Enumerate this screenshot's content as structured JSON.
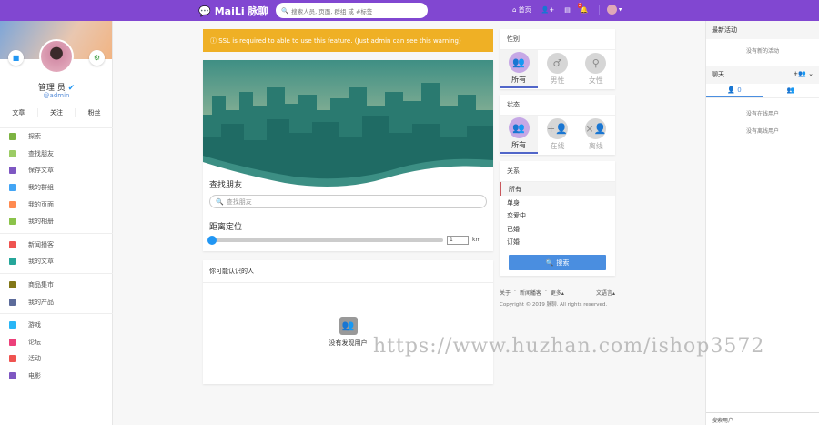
{
  "topbar": {
    "logo": "MaiLi 脉聊",
    "search_placeholder": "搜索人员, 页面, 群组 或 #标签",
    "home": "首页",
    "notification_count": "2"
  },
  "profile": {
    "name": "管理 员",
    "handle": "@admin",
    "stats": [
      "文章",
      "关注",
      "粉丝"
    ]
  },
  "menu": [
    [
      {
        "label": "探索",
        "color": "#7cb342"
      },
      {
        "label": "查找朋友",
        "color": "#9ccc65"
      },
      {
        "label": "保存文章",
        "color": "#7e57c2"
      },
      {
        "label": "我的群组",
        "color": "#42a5f5"
      },
      {
        "label": "我的页面",
        "color": "#ff8a50"
      },
      {
        "label": "我的相册",
        "color": "#8bc34a"
      }
    ],
    [
      {
        "label": "新闻播客",
        "color": "#ef5350"
      },
      {
        "label": "我的文章",
        "color": "#26a69a"
      }
    ],
    [
      {
        "label": "商品集市",
        "color": "#827717"
      },
      {
        "label": "我的产品",
        "color": "#5c6b9a"
      }
    ],
    [
      {
        "label": "游戏",
        "color": "#29b6f6"
      },
      {
        "label": "论坛",
        "color": "#ec407a"
      },
      {
        "label": "活动",
        "color": "#ef5350"
      },
      {
        "label": "电影",
        "color": "#7e57c2"
      }
    ]
  ],
  "warning": "SSL is required to able to use this feature. (Just admin can see this warning)",
  "find": {
    "title": "查找朋友",
    "placeholder": "查找朋友",
    "distance_title": "距离定位",
    "distance_value": "1",
    "unit": "km",
    "slider_fraction": 0
  },
  "suggest": {
    "title": "你可能认识的人",
    "empty": "没有发现用户"
  },
  "filters": {
    "gender": {
      "title": "性别",
      "options": [
        "所有",
        "男性",
        "女性"
      ]
    },
    "status": {
      "title": "状态",
      "options": [
        "所有",
        "在线",
        "离线"
      ]
    },
    "relation": {
      "title": "关系",
      "options": [
        "所有",
        "单身",
        "恋爱中",
        "已婚",
        "订婚"
      ]
    },
    "search_btn": "搜索"
  },
  "footer": {
    "links": [
      "关于",
      "新闻播客",
      "更多"
    ],
    "language": "语言",
    "copyright": "Copyright © 2019 脉聊. All rights reserved."
  },
  "right": {
    "activity_title": "最新活动",
    "activity_empty": "没有新的活动",
    "chat_title": "聊天",
    "online_count": "0",
    "no_online": "没有在线用户",
    "no_offline": "没有离线用户",
    "search_users": "搜索用户"
  },
  "watermark": "https://www.huzhan.com/ishop3572"
}
